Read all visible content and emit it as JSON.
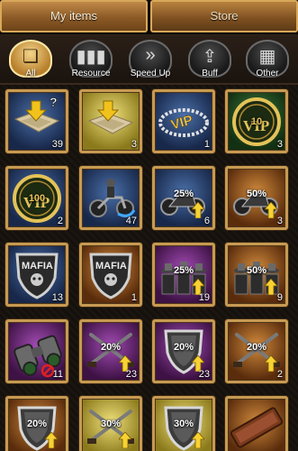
{
  "tabs": {
    "my_items": "My items",
    "store": "Store"
  },
  "categories": [
    {
      "label": "All",
      "icon": "❏",
      "active": true
    },
    {
      "label": "Resource",
      "icon": "▮▮▮",
      "active": false
    },
    {
      "label": "Speed Up",
      "icon": "»",
      "active": false
    },
    {
      "label": "Buff",
      "icon": "⇪",
      "active": false
    },
    {
      "label": "Other",
      "icon": "▦",
      "active": false
    }
  ],
  "items": [
    {
      "art": "map-teleport-random",
      "bg": "blue",
      "count": "39",
      "pct": ""
    },
    {
      "art": "map-teleport",
      "bg": "yellow",
      "count": "3",
      "pct": ""
    },
    {
      "art": "vip-chain",
      "bg": "blue",
      "count": "1",
      "pct": ""
    },
    {
      "art": "vip-10-coin",
      "bg": "green",
      "count": "3",
      "pct": "10"
    },
    {
      "art": "vip-100-coin",
      "bg": "blue",
      "count": "2",
      "pct": "100"
    },
    {
      "art": "biker",
      "bg": "blue",
      "count": "47",
      "pct": ""
    },
    {
      "art": "motorcycle",
      "bg": "blue",
      "count": "6",
      "pct": "25%"
    },
    {
      "art": "motorcycle",
      "bg": "orange",
      "count": "3",
      "pct": "50%"
    },
    {
      "art": "mafia-shield",
      "bg": "blue",
      "count": "13",
      "pct": ""
    },
    {
      "art": "mafia-shield",
      "bg": "orange",
      "count": "1",
      "pct": ""
    },
    {
      "art": "gangsters",
      "bg": "purple",
      "count": "19",
      "pct": "25%"
    },
    {
      "art": "gangsters",
      "bg": "orange",
      "count": "9",
      "pct": "50%"
    },
    {
      "art": "binoculars",
      "bg": "purple",
      "count": "11",
      "pct": ""
    },
    {
      "art": "crossed-guns",
      "bg": "purple",
      "count": "23",
      "pct": "20%"
    },
    {
      "art": "shield-badge",
      "bg": "purple",
      "count": "23",
      "pct": "20%"
    },
    {
      "art": "crossed-guns",
      "bg": "orange",
      "count": "2",
      "pct": "20%"
    },
    {
      "art": "shield-badge",
      "bg": "orange",
      "count": "",
      "pct": "20%"
    },
    {
      "art": "crossed-guns",
      "bg": "yellow",
      "count": "",
      "pct": "30%"
    },
    {
      "art": "shield-badge",
      "bg": "yellow",
      "count": "",
      "pct": "30%"
    },
    {
      "art": "city-sign",
      "bg": "orange",
      "count": "",
      "pct": ""
    }
  ]
}
